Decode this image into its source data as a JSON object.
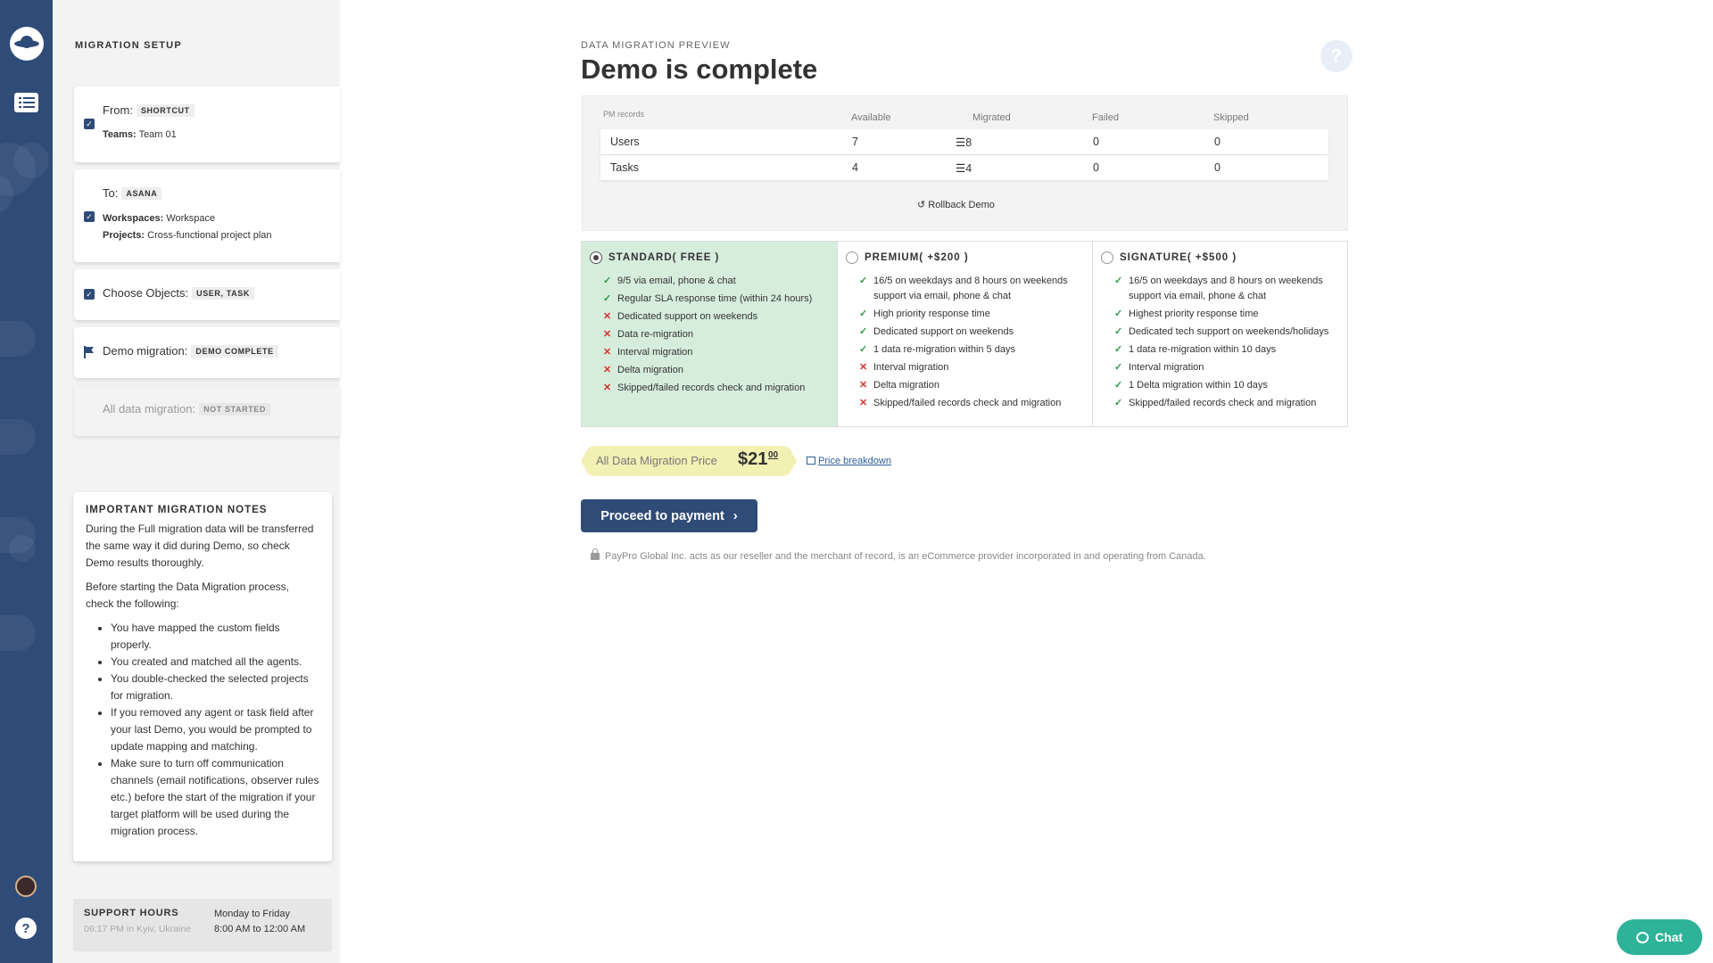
{
  "setup": {
    "heading": "MIGRATION SETUP",
    "from": {
      "label": "From:",
      "tag": "SHORTCUT",
      "teams_label": "Teams:",
      "teams_value": "Team 01"
    },
    "to": {
      "label": "To:",
      "tag": "ASANA",
      "workspaces_label": "Workspaces:",
      "workspaces_value": "Workspace",
      "projects_label": "Projects:",
      "projects_value": "Cross-functional project plan"
    },
    "objects": {
      "label": "Choose Objects:",
      "tag": "USER, TASK"
    },
    "demo": {
      "label": "Demo migration:",
      "tag": "DEMO COMPLETE"
    },
    "all_data": {
      "label": "All data migration:",
      "tag": "NOT STARTED"
    }
  },
  "notes": {
    "heading": "IMPORTANT MIGRATION NOTES",
    "p1": "During the Full migration data will be transferred the same way it did during Demo, so check Demo results thoroughly.",
    "p2": "Before starting the Data Migration process, check the following:",
    "items": [
      "You have mapped the custom fields properly.",
      "You created and matched all the agents.",
      "You double-checked the selected projects for migration.",
      "If you removed any agent or task field after your last Demo, you would be prompted to update mapping and matching.",
      "Make sure to turn off communication channels (email notifications, observer rules etc.) before the start of the migration if your target platform will be used during the migration process."
    ]
  },
  "support": {
    "label": "SUPPORT HOURS",
    "local_time": "06:17 PM in Kyiv, Ukraine",
    "days": "Monday to Friday",
    "hours": "8:00 AM to 12:00 AM"
  },
  "main": {
    "eyebrow": "DATA MIGRATION PREVIEW",
    "title": "Demo is complete",
    "help_glyph": "?"
  },
  "records": {
    "headers": {
      "records": "PM records",
      "available": "Available",
      "migrated": "Migrated",
      "failed": "Failed",
      "skipped": "Skipped"
    },
    "rows": [
      {
        "name": "Users",
        "available": "7",
        "migrated": "8",
        "failed": "0",
        "skipped": "0"
      },
      {
        "name": "Tasks",
        "available": "4",
        "migrated": "4",
        "failed": "0",
        "skipped": "0"
      }
    ],
    "rollback": "Rollback Demo"
  },
  "plans": [
    {
      "name": "STANDARD( FREE )",
      "selected": true,
      "features": [
        {
          "text": "9/5 via email, phone & chat",
          "ok": true
        },
        {
          "text": "Regular SLA response time (within 24 hours)",
          "ok": true
        },
        {
          "text": "Dedicated support on weekends",
          "ok": false
        },
        {
          "text": "Data re-migration",
          "ok": false
        },
        {
          "text": "Interval migration",
          "ok": false
        },
        {
          "text": "Delta migration",
          "ok": false
        },
        {
          "text": "Skipped/failed records check and migration",
          "ok": false
        }
      ]
    },
    {
      "name": "PREMIUM( +$200 )",
      "selected": false,
      "features": [
        {
          "text": "16/5 on weekdays and 8 hours on weekends support via email, phone & chat",
          "ok": true
        },
        {
          "text": "High priority response time",
          "ok": true
        },
        {
          "text": "Dedicated support on weekends",
          "ok": true
        },
        {
          "text": "1 data re-migration within 5 days",
          "ok": true
        },
        {
          "text": "Interval migration",
          "ok": false
        },
        {
          "text": "Delta migration",
          "ok": false
        },
        {
          "text": "Skipped/failed records check and migration",
          "ok": false
        }
      ]
    },
    {
      "name": "SIGNATURE( +$500 )",
      "selected": false,
      "features": [
        {
          "text": "16/5 on weekdays and 8 hours on weekends support via email, phone & chat",
          "ok": true
        },
        {
          "text": "Highest priority response time",
          "ok": true
        },
        {
          "text": "Dedicated tech support on weekends/holidays",
          "ok": true
        },
        {
          "text": "1 data re-migration within 10 days",
          "ok": true
        },
        {
          "text": "Interval migration",
          "ok": true
        },
        {
          "text": "1 Delta migration within 10 days",
          "ok": true
        },
        {
          "text": "Skipped/failed records check and migration",
          "ok": true
        }
      ]
    }
  ],
  "price": {
    "label": "All Data Migration Price",
    "amount": "$21",
    "cents": "00",
    "breakdown": "Price breakdown"
  },
  "pay_button": "Proceed to payment",
  "disclaimer": "PayPro Global Inc. acts as our reseller and the merchant of record, is an eCommerce provider incorporated in and operating from Canada.",
  "chat": "Chat",
  "colors": {
    "brand": "#2f4b77",
    "selected_plan": "#d6eddc",
    "price_bg": "#f3f0b4",
    "chat": "#2eb398",
    "ok": "#2e9a4a",
    "no": "#d0342c"
  },
  "icons": [
    "app-logo-icon",
    "list-icon",
    "avatar",
    "help-icon",
    "flag-icon",
    "checkbox-checked-icon",
    "rollback-icon",
    "lock-icon",
    "chat-icon",
    "table-icon",
    "chevron-right-icon"
  ]
}
